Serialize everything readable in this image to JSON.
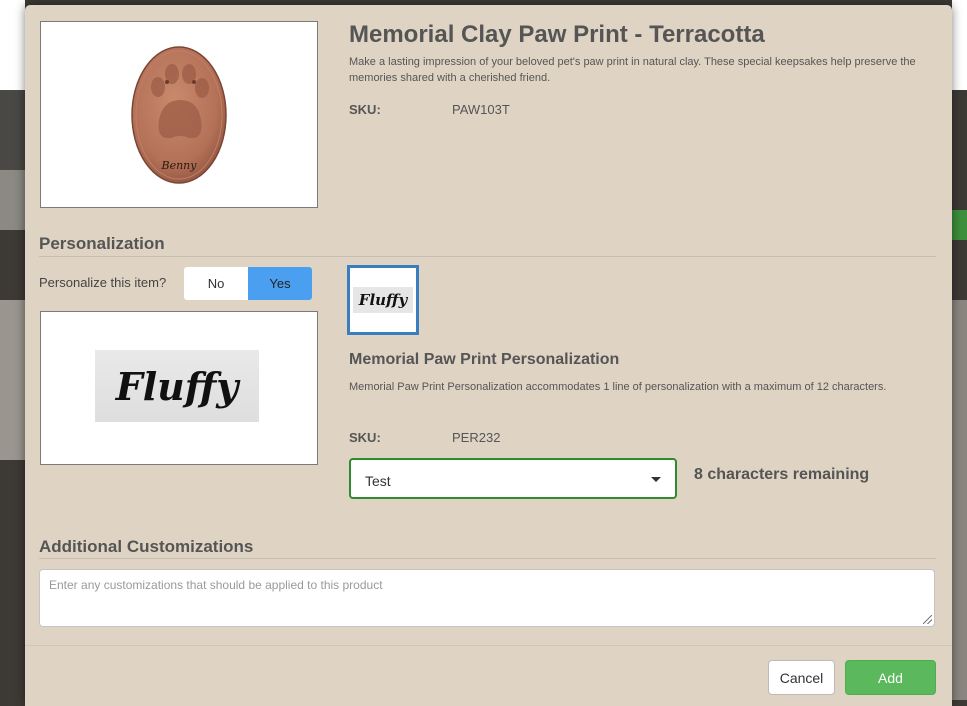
{
  "product": {
    "title": "Memorial Clay Paw Print - Terracotta",
    "description": "Make a lasting impression of your beloved pet's paw print in natural clay. These special keepsakes help preserve the memories shared with a cherished friend.",
    "sku_label": "SKU:",
    "sku": "PAW103T",
    "image_name_text": "Benny",
    "clay_color": "#b9775c"
  },
  "personalization": {
    "heading": "Personalization",
    "prompt": "Personalize this item?",
    "no_label": "No",
    "yes_label": "Yes",
    "selected": "Yes",
    "preview_text": "Fluffy",
    "thumbnail_text": "Fluffy",
    "option_title": "Memorial Paw Print Personalization",
    "option_description": "Memorial Paw Print Personalization accommodates 1 line of personalization with a maximum of 12 characters.",
    "sku_label": "SKU:",
    "sku": "PER232",
    "input_value": "Test",
    "chars_remaining": "8 characters remaining"
  },
  "additional": {
    "heading": "Additional Customizations",
    "placeholder": "Enter any customizations that should be applied to this product"
  },
  "footer": {
    "cancel_label": "Cancel",
    "add_label": "Add"
  },
  "colors": {
    "modal_bg": "#dfd4c4",
    "yes_active": "#4a9ff0",
    "add_button": "#5cb85c",
    "select_border": "#2e8b2e",
    "thumb_border": "#3b7ec0"
  }
}
